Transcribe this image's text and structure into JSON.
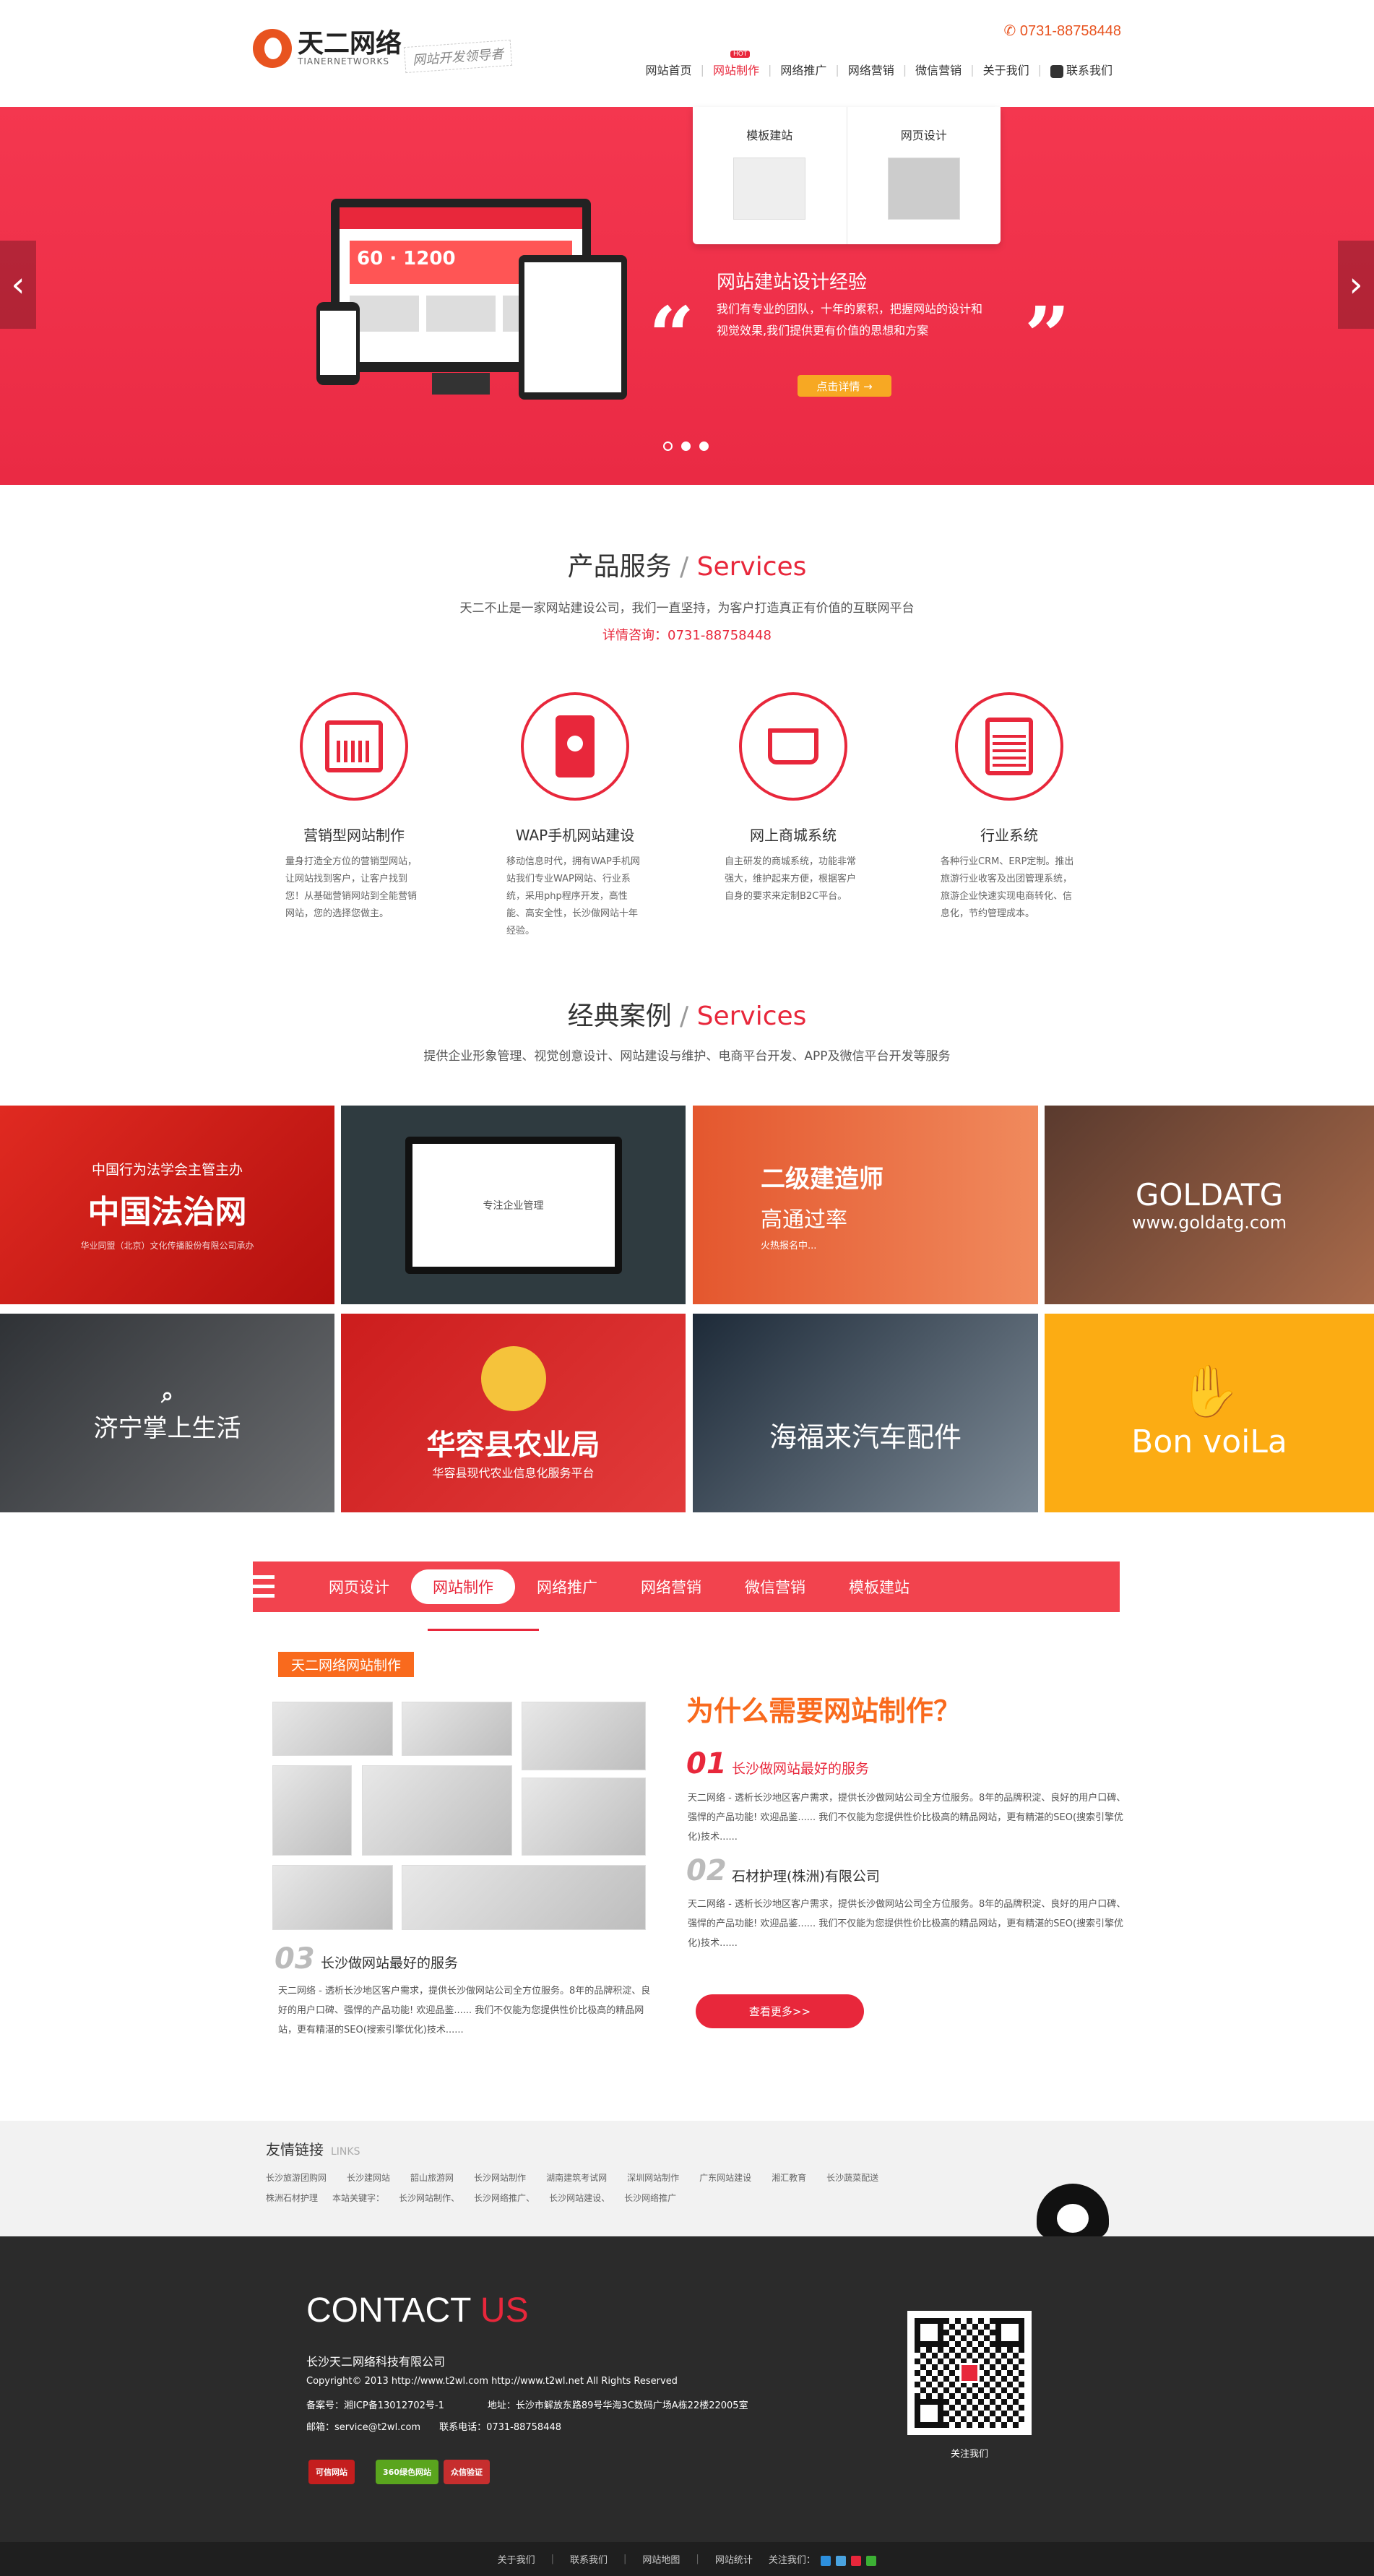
{
  "header": {
    "logo_name": "天二网络",
    "logo_en": "TIANERNETWORKS",
    "slogan": "网站开发领导者",
    "phone": "0731-88758448",
    "nav": [
      {
        "label": "网站首页"
      },
      {
        "label": "网站制作",
        "badge": "HOT"
      },
      {
        "label": "网络推广"
      },
      {
        "label": "网络营销"
      },
      {
        "label": "微信营销"
      },
      {
        "label": "关于我们"
      },
      {
        "label": "联系我们"
      }
    ],
    "dropdown": [
      "模板建站",
      "网页设计"
    ]
  },
  "banner": {
    "title": "网站建站设计经验",
    "desc": "我们有专业的团队，十年的累积，把握网站的设计和视觉效果,我们提供更有价值的思想和方案",
    "button": "点击详情 →",
    "prev": "‹",
    "next": "›",
    "screen_big": "60",
    "screen_mid": "1200"
  },
  "services": {
    "title_cn": "产品服务",
    "title_en": "Services",
    "subtitle": "天二不止是一家网站建设公司，我们一直坚持，为客户打造真正有价值的互联网平台",
    "hotline": "详情咨询：0731-88758448",
    "items": [
      {
        "title": "营销型网站制作",
        "text": "量身打造全方位的营销型网站，让网站找到客户，让客户找到您！从基础营销网站到全能营销网站，您的选择您做主。",
        "icon": "chart-icon"
      },
      {
        "title": "WAP手机网站建设",
        "text": "移动信息时代，拥有WAP手机网站我们专业WAP网站、行业系统，采用php程序开发，高性能、高安全性，长沙做网站十年经验。",
        "icon": "mobile-icon"
      },
      {
        "title": "网上商城系统",
        "text": "自主研发的商城系统，功能非常强大，维护起来方便，根据客户自身的要求来定制B2C平台。",
        "icon": "cart-icon"
      },
      {
        "title": "行业系统",
        "text": "各种行业CRM、ERP定制。推出旅游行业收客及出团管理系统，旅游企业快速实现电商转化、信息化，节约管理成本。",
        "icon": "news-icon"
      }
    ]
  },
  "cases": {
    "title_cn": "经典案例",
    "title_en": "Services",
    "subtitle": "提供企业形象管理、视觉创意设计、网站建设与维护、电商平台开发、APP及微信平台开发等服务",
    "items": [
      {
        "title": "中国法治网",
        "sub": "中国行为法学会主管主办",
        "sub2": "华业同盟（北京）文化传播股份有限公司承办"
      },
      {
        "title": "",
        "sub": "专注企业管理"
      },
      {
        "title": "二级建造师",
        "sub": "高通过率",
        "sub2": "火热报名中..."
      },
      {
        "title": "GOLDATG",
        "sub": "www.goldatg.com"
      },
      {
        "title": "济宁掌上生活",
        "sub": ""
      },
      {
        "title": "华容县农业局",
        "sub": "华容县现代农业信息化服务平台"
      },
      {
        "title": "海福来汽车配件",
        "sub": ""
      },
      {
        "title": "Bon voiLa",
        "sub": ""
      }
    ]
  },
  "tabs": {
    "items": [
      "网页设计",
      "网站制作",
      "网络推广",
      "网络营销",
      "微信营销",
      "模板建站"
    ],
    "active": 1,
    "tagline": "天二网络网站制作",
    "why": "为什么需要网站制作？",
    "list": [
      {
        "num": "01",
        "title": "长沙做网站最好的服务",
        "text": "天二网络 - 透析长沙地区客户需求，提供长沙做网站公司全方位服务。8年的品牌积淀、良好的用户口碑、强悍的产品功能! 欢迎品鉴...... 我们不仅能为您提供性价比极高的精品网站，更有精湛的SEO(搜索引擎优化)技术......"
      },
      {
        "num": "02",
        "title": "石材护理(株洲)有限公司",
        "text": "天二网络 - 透析长沙地区客户需求，提供长沙做网站公司全方位服务。8年的品牌积淀、良好的用户口碑、强悍的产品功能! 欢迎品鉴...... 我们不仅能为您提供性价比极高的精品网站，更有精湛的SEO(搜索引擎优化)技术......"
      },
      {
        "num": "03",
        "title": "长沙做网站最好的服务",
        "text": "天二网络 - 透析长沙地区客户需求，提供长沙做网站公司全方位服务。8年的品牌积淀、良好的用户口碑、强悍的产品功能! 欢迎品鉴...... 我们不仅能为您提供性价比极高的精品网站，更有精湛的SEO(搜索引擎优化)技术......"
      }
    ],
    "more": "查看更多>>"
  },
  "links": {
    "title": "友情链接",
    "title_en": "LINKS",
    "row1": [
      "长沙旅游团购网",
      "长沙建网站",
      "韶山旅游网",
      "长沙网站制作",
      "湖南建筑考试网",
      "深圳网站制作",
      "广东网站建设",
      "湘汇教育",
      "长沙蔬菜配送"
    ],
    "row2": [
      "株洲石材护理",
      "本站关键字：",
      "长沙网站制作、",
      "长沙网络推广、",
      "长沙网站建设、",
      "长沙网络推广"
    ]
  },
  "footer": {
    "contact_a": "CONTACT",
    "contact_b": "US",
    "company": "长沙天二网络科技有限公司",
    "copyright": "Copyright© 2013 http://www.t2wl.com http://www.t2wl.net All Rights Reserved",
    "icp": "备案号：湘ICP备13012702号-1",
    "address": "地址：长沙市解放东路89号华海3C数码广场A栋22楼22005室",
    "email": "邮箱：service@t2wl.com",
    "tel": "联系电话：0731-88758448",
    "badges": [
      "可信网站",
      "360绿色网站",
      "众信验证"
    ],
    "qr_label": "关注我们",
    "bottom": [
      "关于我们",
      "联系我们",
      "网站地图",
      "网站统计",
      "关注我们："
    ]
  },
  "colors": {
    "accent": "#e8273b",
    "orange": "#f96a1d",
    "banner": "#f0344d"
  }
}
